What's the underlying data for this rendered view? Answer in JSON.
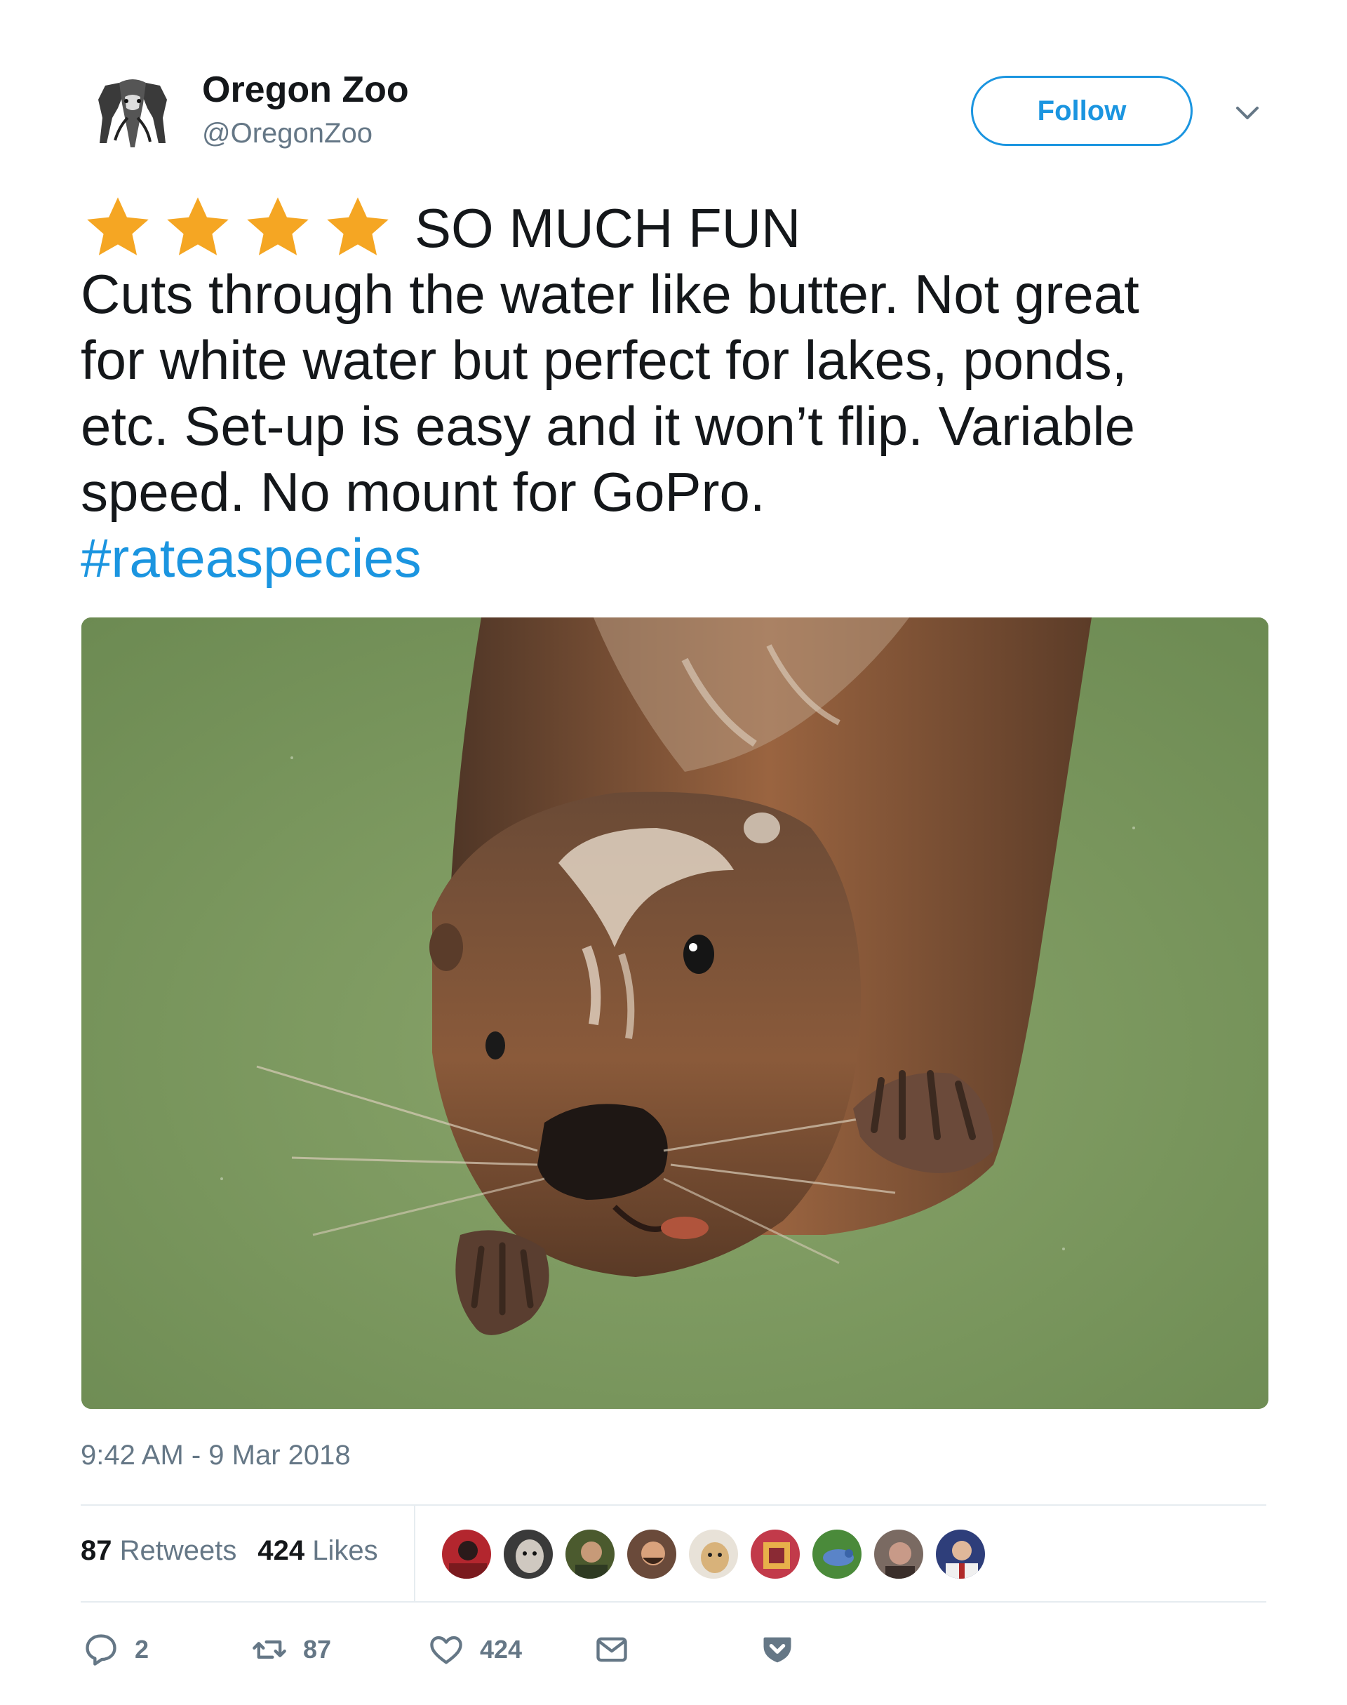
{
  "account": {
    "display_name": "Oregon Zoo",
    "handle": "@OregonZoo",
    "avatar_icon": "elephant-logo"
  },
  "header": {
    "follow_label": "Follow",
    "menu_icon": "chevron-down-icon"
  },
  "tweet": {
    "rating_stars": 4,
    "headline": "SO MUCH FUN",
    "body_lines": [
      "Cuts through the water like butter. Not great",
      "for white water but perfect for lakes, ponds,",
      "etc. Set-up is easy and it won’t flip. Variable",
      "speed. No mount for GoPro."
    ],
    "hashtag": "#rateaspecies",
    "media_icon": "otter-photo"
  },
  "timestamp": "9:42 AM - 9 Mar 2018",
  "stats": {
    "retweets_count": "87",
    "retweets_label": "Retweets",
    "likes_count": "424",
    "likes_label": "Likes",
    "liker_avatars": 9
  },
  "actions": {
    "reply_count": "2",
    "retweet_count": "87",
    "like_count": "424"
  },
  "colors": {
    "accent": "#1b95e0",
    "star": "#f5a623",
    "secondary_text": "#657786",
    "divider": "#e6ecf0"
  }
}
